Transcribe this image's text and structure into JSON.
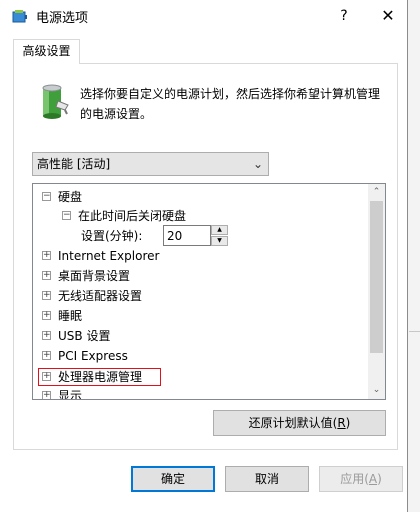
{
  "window": {
    "title": "电源选项",
    "help_label": "?",
    "close_label": "✕"
  },
  "tab": {
    "label": "高级设置"
  },
  "description": "选择你要自定义的电源计划，然后选择你希望计算机管理的电源设置。",
  "plan_select": {
    "value": "高性能 [活动]"
  },
  "tree": {
    "items": [
      {
        "label": "硬盘",
        "toggle": "⊟",
        "expanded": true
      },
      {
        "label": "在此时间后关闭硬盘",
        "toggle": "⊟",
        "expanded": true
      },
      {
        "label": "设置(分钟):"
      },
      {
        "label": "Internet Explorer",
        "toggle": "+"
      },
      {
        "label": "桌面背景设置",
        "toggle": "+"
      },
      {
        "label": "无线适配器设置",
        "toggle": "+"
      },
      {
        "label": "睡眠",
        "toggle": "+"
      },
      {
        "label": "USB 设置",
        "toggle": "+"
      },
      {
        "label": "PCI Express",
        "toggle": "+"
      },
      {
        "label": "处理器电源管理",
        "toggle": "+",
        "highlighted": true
      },
      {
        "label": "显示",
        "toggle": "+"
      }
    ],
    "setting_value": "20"
  },
  "buttons": {
    "restore": {
      "label": "还原计划默认值(",
      "hotkey": "R",
      "suffix": ")"
    },
    "ok": "确定",
    "cancel": "取消",
    "apply": {
      "label": "应用(",
      "hotkey": "A",
      "suffix": ")",
      "disabled": true
    }
  },
  "colors": {
    "highlight": "#e0111b",
    "default_button_border": "#0078d7"
  }
}
